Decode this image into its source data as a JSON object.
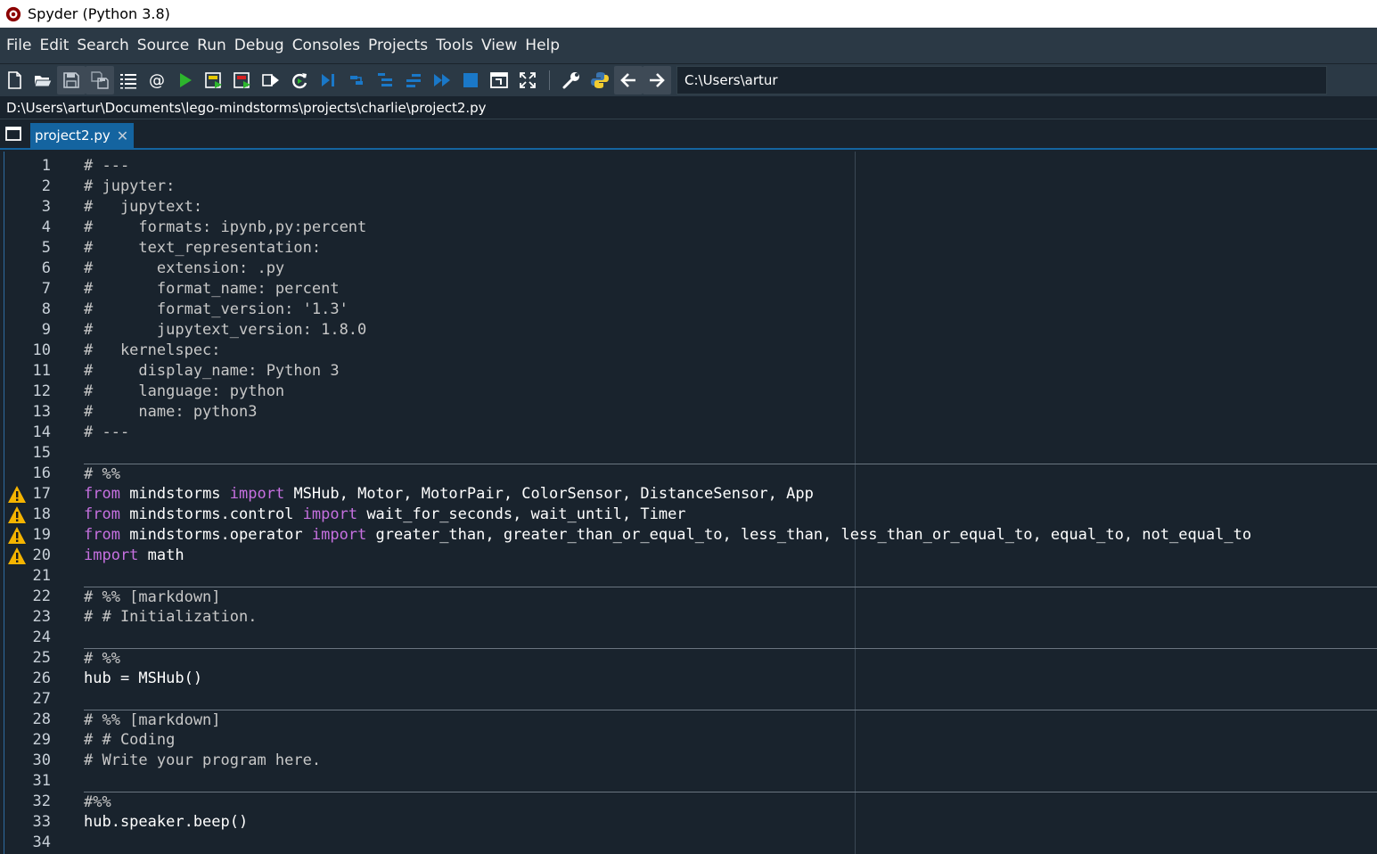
{
  "window": {
    "title": "Spyder (Python 3.8)"
  },
  "menu": [
    "File",
    "Edit",
    "Search",
    "Source",
    "Run",
    "Debug",
    "Consoles",
    "Projects",
    "Tools",
    "View",
    "Help"
  ],
  "toolbar": {
    "icons": [
      "new-file",
      "open-file",
      "save-file",
      "save-all",
      "outline",
      "email-at",
      "run",
      "run-cell",
      "run-cell-advance",
      "run-selection",
      "rerun",
      "debug",
      "debug-step",
      "debug-step-into",
      "debug-step-return",
      "debug-continue",
      "debug-stop",
      "maximize-pane",
      "fullscreen",
      "preferences-wrench",
      "python-path",
      "back-arrow",
      "forward-arrow"
    ],
    "working_dir": "C:\\Users\\artur"
  },
  "editor": {
    "file_path": "D:\\Users\\artur\\Documents\\lego-mindstorms\\projects\\charlie\\project2.py",
    "tab_label": "project2.py",
    "lines": [
      {
        "n": "1",
        "text": "# ---",
        "kind": "comment"
      },
      {
        "n": "2",
        "text": "# jupyter:",
        "kind": "comment"
      },
      {
        "n": "3",
        "text": "#   jupytext:",
        "kind": "comment"
      },
      {
        "n": "4",
        "text": "#     formats: ipynb,py:percent",
        "kind": "comment"
      },
      {
        "n": "5",
        "text": "#     text_representation:",
        "kind": "comment"
      },
      {
        "n": "6",
        "text": "#       extension: .py",
        "kind": "comment"
      },
      {
        "n": "7",
        "text": "#       format_name: percent",
        "kind": "comment"
      },
      {
        "n": "8",
        "text": "#       format_version: '1.3'",
        "kind": "comment"
      },
      {
        "n": "9",
        "text": "#       jupytext_version: 1.8.0",
        "kind": "comment"
      },
      {
        "n": "10",
        "text": "#   kernelspec:",
        "kind": "comment"
      },
      {
        "n": "11",
        "text": "#     display_name: Python 3",
        "kind": "comment"
      },
      {
        "n": "12",
        "text": "#     language: python",
        "kind": "comment"
      },
      {
        "n": "13",
        "text": "#     name: python3",
        "kind": "comment"
      },
      {
        "n": "14",
        "text": "# ---",
        "kind": "comment"
      },
      {
        "n": "15",
        "text": "",
        "kind": "blank"
      },
      {
        "n": "16",
        "text": "# %%",
        "kind": "cell"
      },
      {
        "n": "17",
        "kind": "import",
        "warn": true,
        "parts": [
          [
            "kw",
            "from"
          ],
          [
            "df",
            " mindstorms "
          ],
          [
            "kw",
            "import"
          ],
          [
            "df",
            " MSHub, Motor, MotorPair, ColorSensor, DistanceSensor, App"
          ]
        ]
      },
      {
        "n": "18",
        "kind": "import",
        "warn": true,
        "parts": [
          [
            "kw",
            "from"
          ],
          [
            "df",
            " mindstorms.control "
          ],
          [
            "kw",
            "import"
          ],
          [
            "df",
            " wait_for_seconds, wait_until, Timer"
          ]
        ]
      },
      {
        "n": "19",
        "kind": "import",
        "warn": true,
        "parts": [
          [
            "kw",
            "from"
          ],
          [
            "df",
            " mindstorms.operator "
          ],
          [
            "kw",
            "import"
          ],
          [
            "df",
            " greater_than, greater_than_or_equal_to, less_than, less_than_or_equal_to, equal_to, not_equal_to"
          ]
        ]
      },
      {
        "n": "20",
        "kind": "import",
        "warn": true,
        "parts": [
          [
            "kw",
            "import"
          ],
          [
            "df",
            " math"
          ]
        ]
      },
      {
        "n": "21",
        "text": "",
        "kind": "blank"
      },
      {
        "n": "22",
        "text": "# %% [markdown]",
        "kind": "cell"
      },
      {
        "n": "23",
        "text": "# # Initialization.",
        "kind": "comment"
      },
      {
        "n": "24",
        "text": "",
        "kind": "blank"
      },
      {
        "n": "25",
        "text": "# %%",
        "kind": "cell"
      },
      {
        "n": "26",
        "text": "hub = MSHub()",
        "kind": "code"
      },
      {
        "n": "27",
        "text": "",
        "kind": "blank"
      },
      {
        "n": "28",
        "text": "# %% [markdown]",
        "kind": "cell"
      },
      {
        "n": "29",
        "text": "# # Coding",
        "kind": "comment"
      },
      {
        "n": "30",
        "text": "# Write your program here.",
        "kind": "comment"
      },
      {
        "n": "31",
        "text": "",
        "kind": "blank"
      },
      {
        "n": "32",
        "text": "#%%",
        "kind": "cell"
      },
      {
        "n": "33",
        "text": "hub.speaker.beep()",
        "kind": "code"
      },
      {
        "n": "34",
        "text": "",
        "kind": "blank"
      }
    ]
  },
  "colors": {
    "background": "#19232d",
    "keyword": "#c670e0",
    "comment": "#c8c8c8",
    "tab": "#1464a0",
    "warning": "#f5b400"
  }
}
